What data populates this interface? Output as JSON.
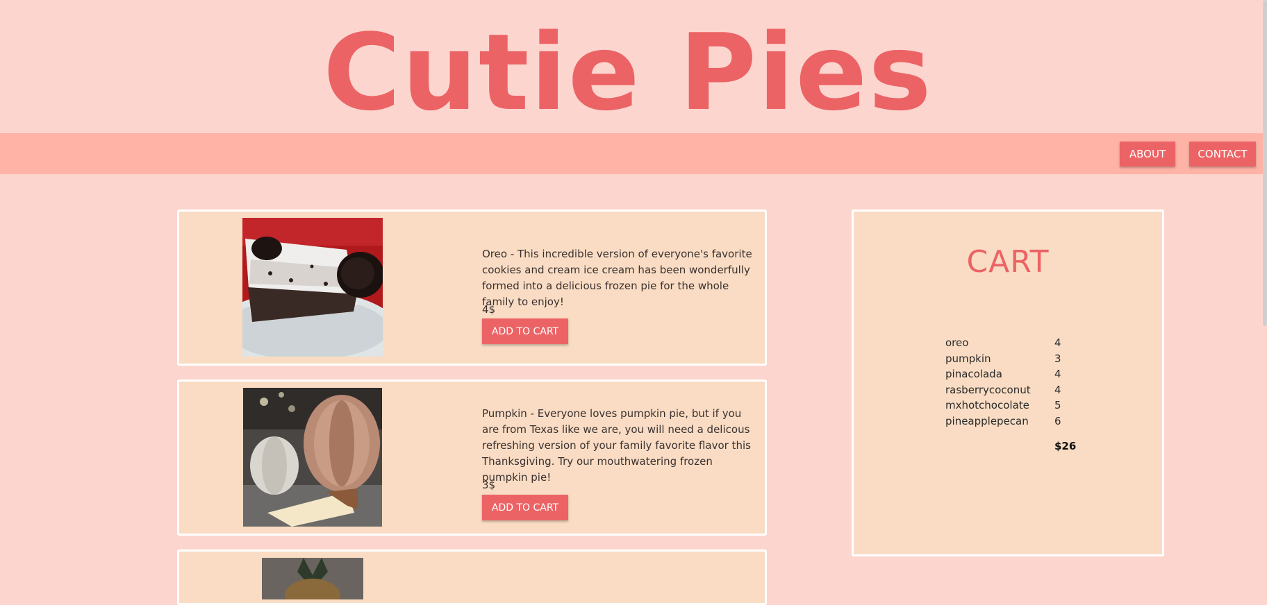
{
  "header": {
    "title": "Cutie Pies"
  },
  "nav": {
    "about_label": "ABOUT",
    "contact_label": "CONTACT"
  },
  "products": [
    {
      "description": "Oreo - This incredible version of everyone's favorite cookies and cream ice cream has been wonderfully formed into a delicious frozen pie for the whole family to enjoy!",
      "price": "4$",
      "button_label": "ADD TO CART"
    },
    {
      "description": "Pumpkin - Everyone loves pumpkin pie, but if you are from Texas like we are, you will need a delicous refreshing version of your family favorite flavor this Thanksgiving. Try our mouthwatering frozen pumpkin pie!",
      "price": "3$",
      "button_label": "ADD TO CART"
    }
  ],
  "cart": {
    "title": "CART",
    "items": [
      {
        "name": "oreo",
        "qty": "4"
      },
      {
        "name": "pumpkin",
        "qty": "3"
      },
      {
        "name": "pinacolada",
        "qty": "4"
      },
      {
        "name": "rasberrycoconut",
        "qty": "4"
      },
      {
        "name": "mxhotchocolate",
        "qty": "5"
      },
      {
        "name": "pineapplepecan",
        "qty": "6"
      }
    ],
    "total": "$26"
  },
  "colors": {
    "background": "#fdd5cf",
    "accent": "#ec6365",
    "navbar": "#feb3a6",
    "card": "#f9dcc3"
  }
}
